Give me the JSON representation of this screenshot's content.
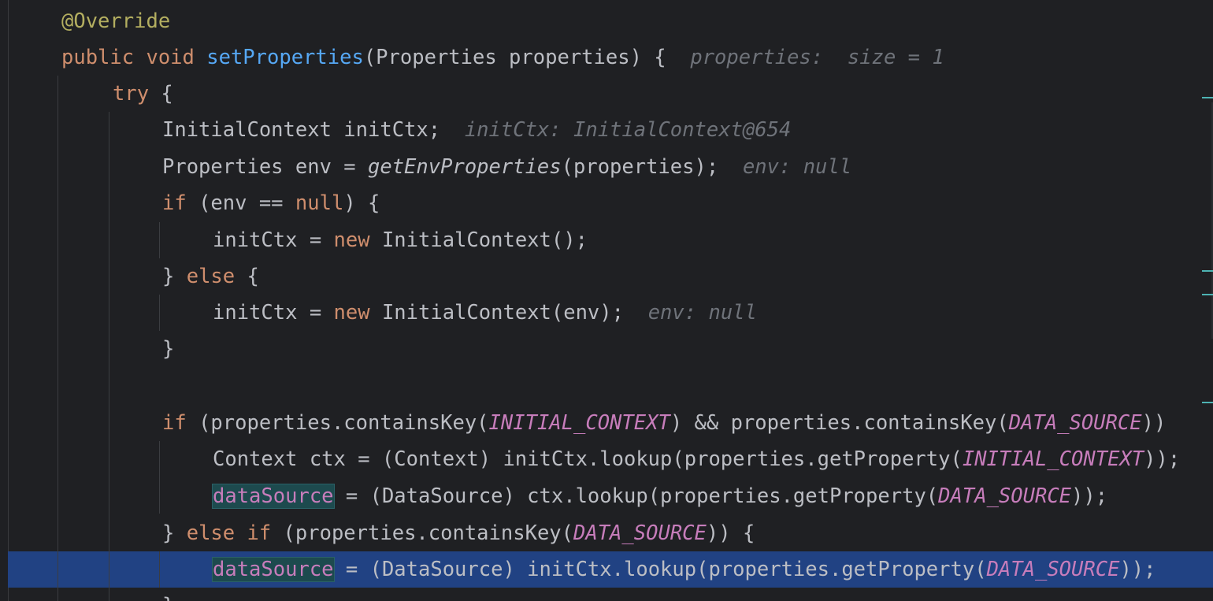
{
  "editor": {
    "lines": [
      {
        "tokens": [
          {
            "t": "@Override",
            "c": "ann"
          }
        ]
      },
      {
        "tokens": [
          {
            "t": "public void ",
            "c": "kw"
          },
          {
            "t": "setProperties",
            "c": "fn"
          },
          {
            "t": "(Properties properties) {  ",
            "c": "plain"
          },
          {
            "t": "properties:  size = 1",
            "c": "hint"
          }
        ]
      },
      {
        "tokens": [
          {
            "t": "try",
            "c": "kw"
          },
          {
            "t": " {",
            "c": "plain"
          }
        ]
      },
      {
        "tokens": [
          {
            "t": "InitialContext initCtx;  ",
            "c": "plain"
          },
          {
            "t": "initCtx: InitialContext@654",
            "c": "hint"
          }
        ]
      },
      {
        "tokens": [
          {
            "t": "Properties env = ",
            "c": "plain"
          },
          {
            "t": "getEnvProperties",
            "c": "sfn"
          },
          {
            "t": "(properties);  ",
            "c": "plain"
          },
          {
            "t": "env: null",
            "c": "hint"
          }
        ]
      },
      {
        "tokens": [
          {
            "t": "if",
            "c": "kw"
          },
          {
            "t": " (env == ",
            "c": "plain"
          },
          {
            "t": "null",
            "c": "kw"
          },
          {
            "t": ") {",
            "c": "plain"
          }
        ]
      },
      {
        "tokens": [
          {
            "t": "initCtx = ",
            "c": "plain"
          },
          {
            "t": "new",
            "c": "kw"
          },
          {
            "t": " InitialContext();",
            "c": "plain"
          }
        ]
      },
      {
        "tokens": [
          {
            "t": "} ",
            "c": "plain"
          },
          {
            "t": "else",
            "c": "kw"
          },
          {
            "t": " {",
            "c": "plain"
          }
        ]
      },
      {
        "tokens": [
          {
            "t": "initCtx = ",
            "c": "plain"
          },
          {
            "t": "new",
            "c": "kw"
          },
          {
            "t": " InitialContext(env);  ",
            "c": "plain"
          },
          {
            "t": "env: null",
            "c": "hint"
          }
        ]
      },
      {
        "tokens": [
          {
            "t": "}",
            "c": "plain"
          }
        ]
      },
      {
        "tokens": []
      },
      {
        "tokens": [
          {
            "t": "if",
            "c": "kw"
          },
          {
            "t": " (properties.containsKey(",
            "c": "plain"
          },
          {
            "t": "INITIAL_CONTEXT",
            "c": "const"
          },
          {
            "t": ") && properties.containsKey(",
            "c": "plain"
          },
          {
            "t": "DATA_SOURCE",
            "c": "const"
          },
          {
            "t": "))",
            "c": "plain"
          }
        ]
      },
      {
        "tokens": [
          {
            "t": "Context ctx = (Context) initCtx.lookup(properties.getProperty(",
            "c": "plain"
          },
          {
            "t": "INITIAL_CONTEXT",
            "c": "const"
          },
          {
            "t": "));",
            "c": "plain"
          }
        ]
      },
      {
        "tokens": [
          {
            "t": "dataSource",
            "c": "fld hl"
          },
          {
            "t": " = (DataSource) ctx.lookup(properties.getProperty(",
            "c": "plain"
          },
          {
            "t": "DATA_SOURCE",
            "c": "const"
          },
          {
            "t": "));",
            "c": "plain"
          }
        ]
      },
      {
        "tokens": [
          {
            "t": "} ",
            "c": "plain"
          },
          {
            "t": "else if",
            "c": "kw"
          },
          {
            "t": " (properties.containsKey(",
            "c": "plain"
          },
          {
            "t": "DATA_SOURCE",
            "c": "const"
          },
          {
            "t": ")) {",
            "c": "plain"
          }
        ]
      },
      {
        "tokens": [
          {
            "t": "dataSource",
            "c": "fld hl"
          },
          {
            "t": " = (DataSource) initCtx.lookup(properties.getProperty(",
            "c": "plain"
          },
          {
            "t": "DATA_SOURCE",
            "c": "const"
          },
          {
            "t": "));",
            "c": "plain"
          }
        ]
      },
      {
        "tokens": [
          {
            "t": "}",
            "c": "plain"
          }
        ]
      }
    ],
    "execution_line": 15,
    "colors": {
      "background": "#1f2023",
      "keyword": "#cf8e6d",
      "annotation": "#b3ae60",
      "method": "#56a8f5",
      "field": "#c77dbb",
      "inlay_hint": "#6f737a",
      "execution_highlight": "#214283"
    }
  }
}
